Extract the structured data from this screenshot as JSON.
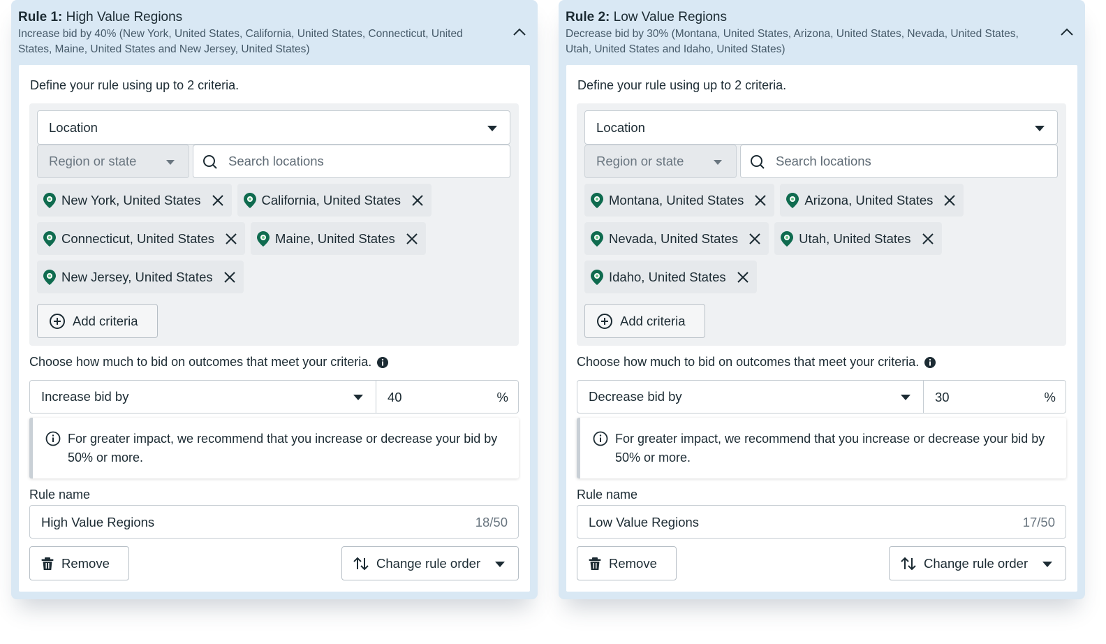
{
  "rules": [
    {
      "number_label": "Rule 1:",
      "title": "High Value Regions",
      "summary": "Increase bid by 40% (New York, United States, California, United States, Connecticut, United States, Maine, United States and New Jersey, United States)",
      "define_label": "Define your rule using up to 2 criteria.",
      "criteria_type": "Location",
      "location_level": "Region or state",
      "search_placeholder": "Search locations",
      "locations": [
        [
          "New York, United States",
          "California, United States"
        ],
        [
          "Connecticut, United States",
          "Maine, United States"
        ],
        [
          "New Jersey, United States"
        ]
      ],
      "add_criteria_label": "Add criteria",
      "bid_label": "Choose how much to bid on outcomes that meet your criteria.",
      "bid_type": "Increase bid by",
      "bid_value": "40",
      "bid_unit": "%",
      "notice": "For greater impact, we recommend that you increase or decrease your bid by 50% or more.",
      "rule_name_label": "Rule name",
      "rule_name": "High Value Regions",
      "rule_name_count": "18/50",
      "remove_label": "Remove",
      "order_label": "Change rule order"
    },
    {
      "number_label": "Rule 2:",
      "title": "Low Value Regions",
      "summary": "Decrease bid by 30% (Montana, United States, Arizona, United States, Nevada, United States, Utah, United States and Idaho, United States)",
      "define_label": "Define your rule using up to 2 criteria.",
      "criteria_type": "Location",
      "location_level": "Region or state",
      "search_placeholder": "Search locations",
      "locations": [
        [
          "Montana, United States",
          "Arizona, United States"
        ],
        [
          "Nevada, United States",
          "Utah, United States"
        ],
        [
          "Idaho, United States"
        ]
      ],
      "add_criteria_label": "Add criteria",
      "bid_label": "Choose how much to bid on outcomes that meet your criteria.",
      "bid_type": "Decrease bid by",
      "bid_value": "30",
      "bid_unit": "%",
      "notice": "For greater impact, we recommend that you increase or decrease your bid by 50% or more.",
      "rule_name_label": "Rule name",
      "rule_name": "Low Value Regions",
      "rule_name_count": "17/50",
      "remove_label": "Remove",
      "order_label": "Change rule order"
    }
  ],
  "icons": {
    "collapse": "chevron-up-icon",
    "dropdown": "caret-down-icon",
    "search": "search-icon",
    "location": "location-pin-icon",
    "remove_chip": "close-icon",
    "add": "plus-circle-icon",
    "info_solid": "info-solid-icon",
    "info": "info-outline-icon",
    "remove": "trash-icon",
    "reorder": "sort-arrows-icon"
  },
  "colors": {
    "card_background": "#d9e8f4",
    "criteria_background": "#eff1f3",
    "chip_background": "#e6e9ec",
    "pin_accent": "#0f6b4f",
    "text_primary": "#1c2b33"
  }
}
